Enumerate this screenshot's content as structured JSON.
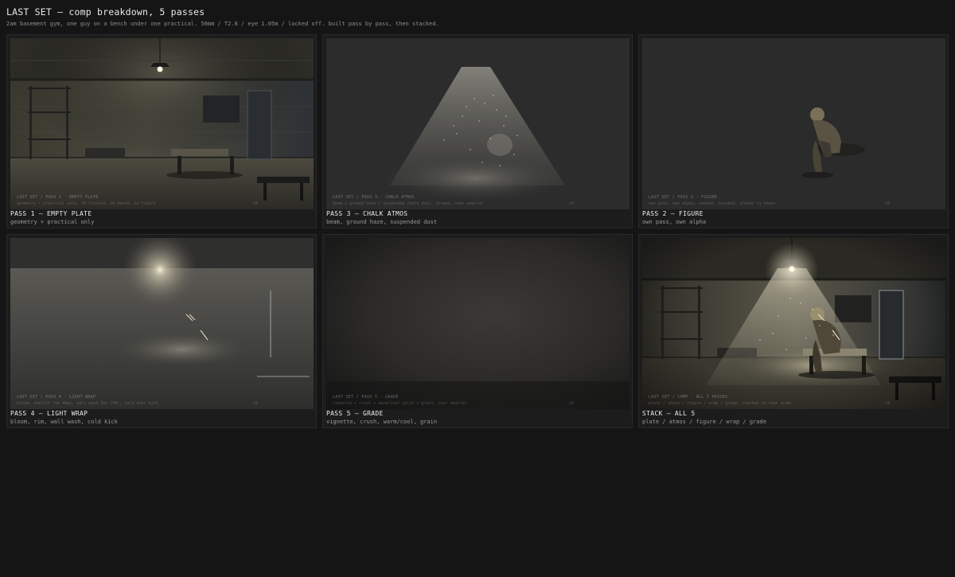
{
  "header": {
    "title": "LAST SET — comp breakdown, 5 passes",
    "subtitle": "2am basement gym, one guy on a bench under one practical. 50mm / T2.8 / eye 1.05m / locked off. built pass by pass, then stacked."
  },
  "colors": {
    "background": "#151515",
    "card": "#1c1c1c",
    "warm_light": "#f4ecd4"
  },
  "cards": [
    {
      "title": "PASS 1 — EMPTY PLATE",
      "sub": "geometry + practical only",
      "slate_title": "LAST SET / PASS 1 - EMPTY PLATE",
      "slate_desc": "geometry + practical only, 50 fixture, 2m bench, no figure",
      "slate_tag": "v4"
    },
    {
      "title": "PASS 3 — CHALK ATMOS",
      "sub": "beam, ground haze, suspended dust",
      "slate_title": "LAST SET / PASS 3 - CHALK ATMOS",
      "slate_desc": "beam + ground haze + suspended chalk dust, screen, over neutral",
      "slate_tag": "v3"
    },
    {
      "title": "PASS 2 — FIGURE",
      "sub": "own pass, own alpha",
      "slate_title": "LAST SET / PASS 2 - FIGURE",
      "slate_desc": "own pass, own alpha, seated, hunched, elbows to knees",
      "slate_tag": "v2"
    },
    {
      "title": "PASS 4 — LIGHT WRAP",
      "sub": "bloom, rim, wall wash, cold kick",
      "slate_title": "LAST SET / PASS 4 - LIGHT WRAP",
      "slate_desc": "bloom, sheriff rim 40px, wall wash 3ev (40), cold door kick",
      "slate_tag": "v2"
    },
    {
      "title": "PASS 5 — GRADE",
      "sub": "vignette, crush, warm/cool, grain",
      "slate_title": "LAST SET / PASS 5 - GRADE",
      "slate_desc": "vignette + crush + warm/cool split + grain, over neutral",
      "slate_tag": "v3"
    },
    {
      "title": "STACK — ALL 5",
      "sub": "plate / atmos / figure / wrap / grade",
      "slate_title": "LAST SET / COMP - ALL 5 PASSES",
      "slate_desc": "plate / atmos / figure / wrap / grade, stacked in that order",
      "slate_tag": "v3"
    }
  ]
}
